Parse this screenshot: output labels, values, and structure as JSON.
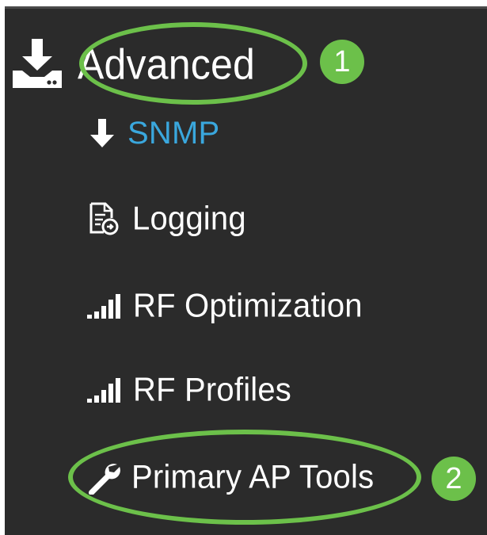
{
  "menu": {
    "section": {
      "label": "Advanced",
      "icon": "download-device-icon"
    },
    "items": [
      {
        "label": "SNMP",
        "icon": "arrow-down-icon",
        "color": "#3aa7dd",
        "active": true
      },
      {
        "label": "Logging",
        "icon": "log-document-icon"
      },
      {
        "label": "RF Optimization",
        "icon": "signal-bars-icon"
      },
      {
        "label": "RF Profiles",
        "icon": "signal-bars-icon"
      },
      {
        "label": "Primary AP Tools",
        "icon": "wrench-icon"
      }
    ]
  },
  "callouts": [
    {
      "number": "1"
    },
    {
      "number": "2"
    }
  ],
  "colors": {
    "panel_bg": "#2b2b2b",
    "text": "#ffffff",
    "active_text": "#3aa7dd",
    "callout_green": "#6cc04a"
  }
}
